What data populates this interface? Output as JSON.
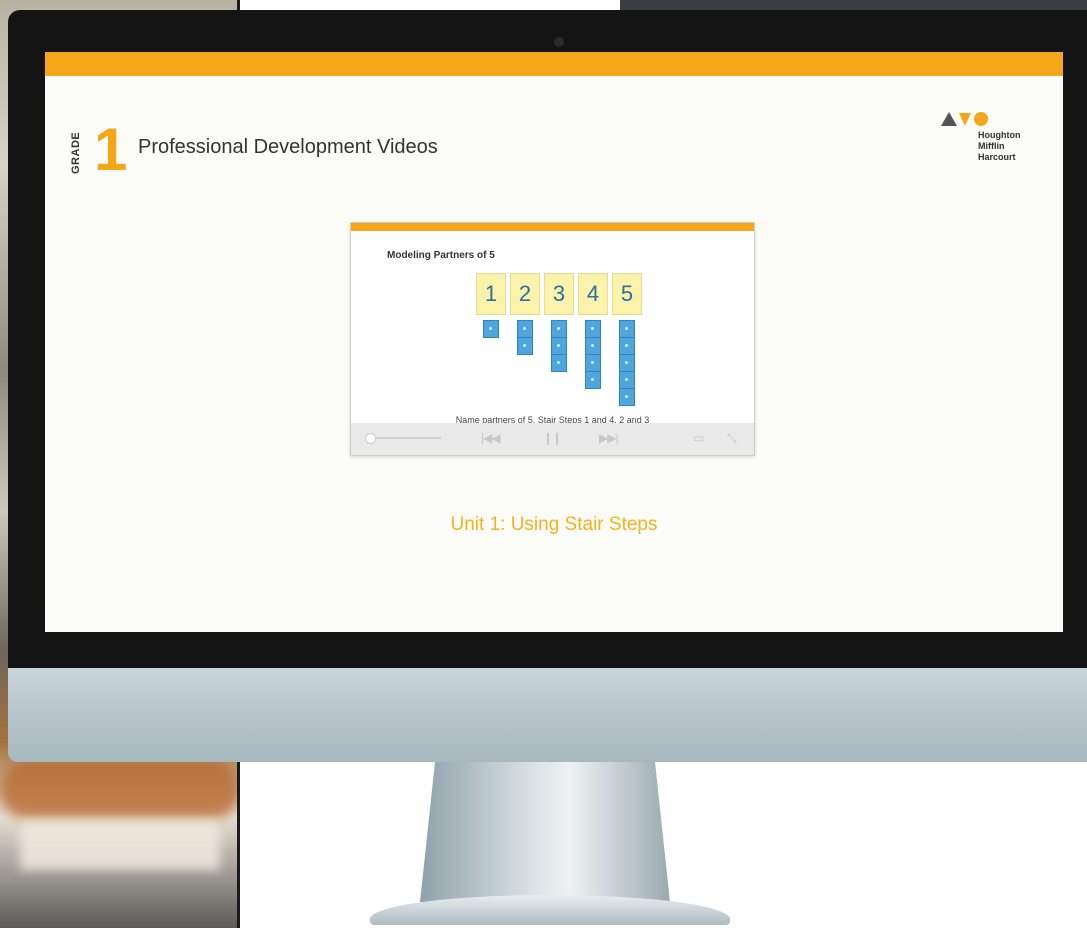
{
  "screen": {
    "grade_label": "GRADE",
    "grade_number": "1",
    "title": "Professional Development Videos",
    "logo": {
      "name_lines": [
        "Houghton",
        "Mifflin",
        "Harcourt"
      ]
    },
    "video": {
      "heading": "Modeling Partners of 5",
      "number_cards": [
        "1",
        "2",
        "3",
        "4",
        "5"
      ],
      "cube_counts": [
        1,
        2,
        3,
        4,
        5
      ],
      "caption": "Name partners of 5. Stair Steps 1 and 4, 2 and 3",
      "controls": {
        "rewind_icon": "rewind-icon",
        "pause_icon": "pause-icon",
        "forward_icon": "fast-forward-icon",
        "captions_icon": "captions-icon",
        "fullscreen_icon": "fullscreen-icon"
      }
    },
    "unit_title": "Unit 1: Using Stair Steps"
  },
  "colors": {
    "accent_orange": "#f5a719",
    "unit_title": "#f2b21f",
    "number_text": "#2a6fa8",
    "cube_blue": "#4fa6de",
    "card_yellow": "#fbf3a9"
  }
}
